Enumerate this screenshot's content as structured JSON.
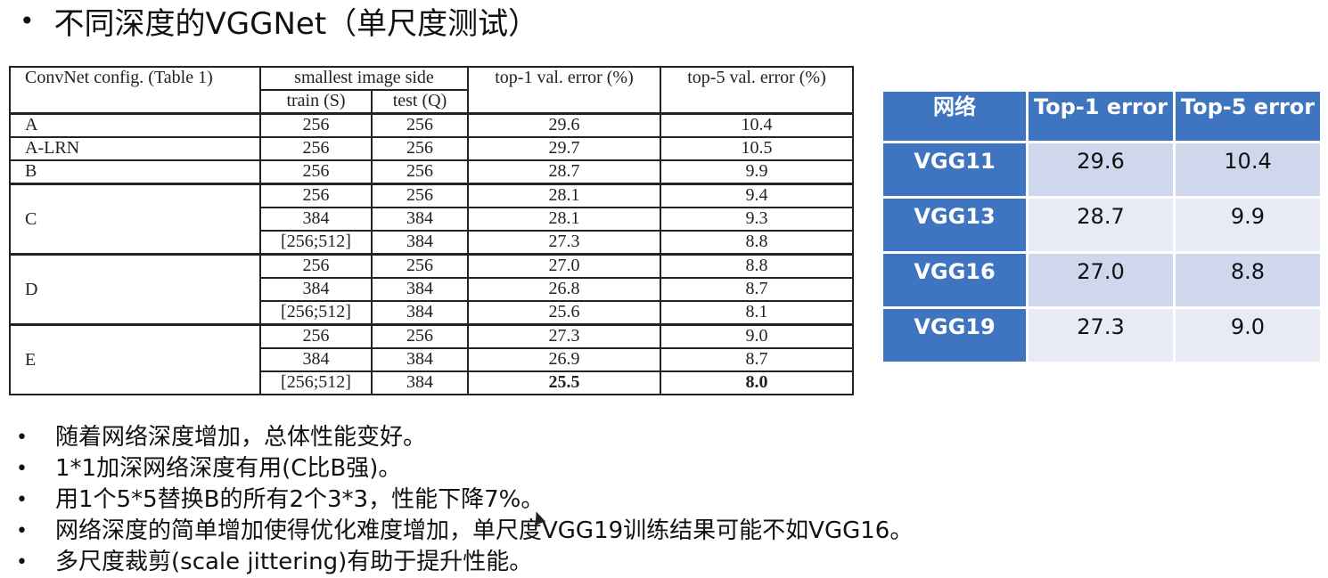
{
  "slide": {
    "bullet_char": "•",
    "title": "不同深度的VGGNet（单尺度测试）"
  },
  "paper_table": {
    "headers": {
      "config": "ConvNet config. (Table 1)",
      "smallest_side": "smallest image side",
      "train": "train (S)",
      "test": "test (Q)",
      "top1": "top-1 val. error (%)",
      "top5": "top-5 val. error (%)"
    },
    "rows": [
      {
        "config": "A",
        "train": "256",
        "test": "256",
        "top1": "29.6",
        "top5": "10.4"
      },
      {
        "config": "A-LRN",
        "train": "256",
        "test": "256",
        "top1": "29.7",
        "top5": "10.5"
      },
      {
        "config": "B",
        "train": "256",
        "test": "256",
        "top1": "28.7",
        "top5": "9.9"
      },
      {
        "config": "C",
        "train": "256",
        "test": "256",
        "top1": "28.1",
        "top5": "9.4"
      },
      {
        "config": "",
        "train": "384",
        "test": "384",
        "top1": "28.1",
        "top5": "9.3"
      },
      {
        "config": "",
        "train": "[256;512]",
        "test": "384",
        "top1": "27.3",
        "top5": "8.8"
      },
      {
        "config": "D",
        "train": "256",
        "test": "256",
        "top1": "27.0",
        "top5": "8.8"
      },
      {
        "config": "",
        "train": "384",
        "test": "384",
        "top1": "26.8",
        "top5": "8.7"
      },
      {
        "config": "",
        "train": "[256;512]",
        "test": "384",
        "top1": "25.6",
        "top5": "8.1"
      },
      {
        "config": "E",
        "train": "256",
        "test": "256",
        "top1": "27.3",
        "top5": "9.0"
      },
      {
        "config": "",
        "train": "384",
        "test": "384",
        "top1": "26.9",
        "top5": "8.7"
      },
      {
        "config": "",
        "train": "[256;512]",
        "test": "384",
        "top1": "25.5",
        "top5": "8.0"
      }
    ]
  },
  "summary_table": {
    "headers": [
      "网络",
      "Top-1 error",
      "Top-5 error"
    ],
    "rows": [
      {
        "net": "VGG11",
        "top1": "29.6",
        "top5": "10.4"
      },
      {
        "net": "VGG13",
        "top1": "28.7",
        "top5": "9.9"
      },
      {
        "net": "VGG16",
        "top1": "27.0",
        "top5": "8.8"
      },
      {
        "net": "VGG19",
        "top1": "27.3",
        "top5": "9.0"
      }
    ],
    "colors": {
      "header_bg": "#3f74c1",
      "row_odd": "#cfd7ed",
      "row_even": "#e8ebf6"
    }
  },
  "notes": [
    "随着网络深度增加，总体性能变好。",
    "1*1加深网络深度有用(C比B强)。",
    "用1个5*5替换B的所有2个3*3，性能下降7%。",
    "网络深度的简单增加使得优化难度增加，单尺度VGG19训练结果可能不如VGG16。",
    "多尺度裁剪(scale jittering)有助于提升性能。"
  ]
}
